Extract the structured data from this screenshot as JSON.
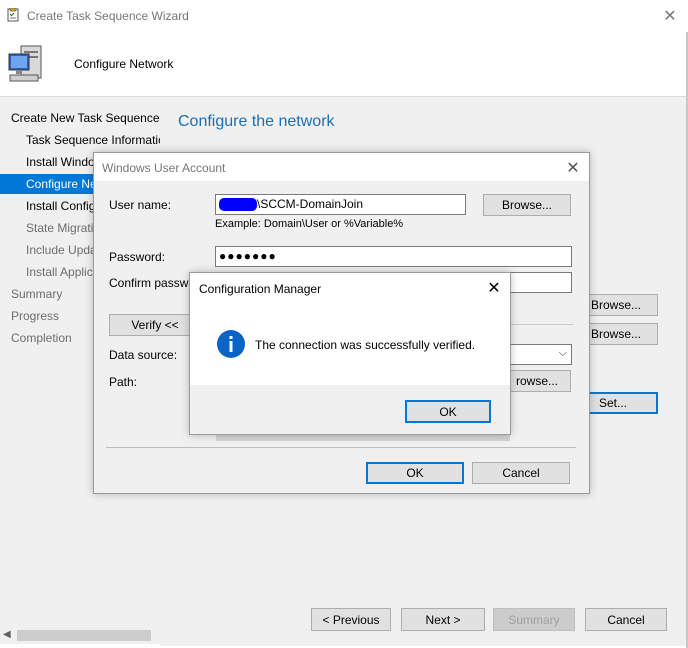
{
  "wizard": {
    "title": "Create Task Sequence Wizard",
    "header_title": "Configure Network",
    "page_heading": "Configure the network",
    "nav": [
      {
        "label": "Create New Task Sequence",
        "state": "normal"
      },
      {
        "label": "Task Sequence Informatic",
        "state": "normal"
      },
      {
        "label": "Install Windo",
        "state": "normal"
      },
      {
        "label": "Configure Ne",
        "state": "selected"
      },
      {
        "label": "Install Config",
        "state": "normal"
      },
      {
        "label": "State Migrati",
        "state": "muted"
      },
      {
        "label": "Include Upda",
        "state": "muted"
      },
      {
        "label": "Install Applic",
        "state": "muted"
      },
      {
        "label": "Summary",
        "state": "muted"
      },
      {
        "label": "Progress",
        "state": "muted"
      },
      {
        "label": "Completion",
        "state": "muted"
      }
    ],
    "behind_buttons": {
      "browse1": "Browse...",
      "browse2": "Browse...",
      "set": "Set..."
    },
    "footer": {
      "previous": "< Previous",
      "next": "Next >",
      "summary": "Summary",
      "cancel": "Cancel"
    },
    "colors": {
      "accent": "#0078d7",
      "heading": "#1a6fb3",
      "nav_selected_bg": "#0078d7"
    }
  },
  "account_dialog": {
    "title": "Windows User Account",
    "user_label": "User name:",
    "user_value": "\\SCCM-DomainJoin",
    "user_example": "Example: Domain\\User or %Variable%",
    "browse": "Browse...",
    "password_label": "Password:",
    "password_value": "●●●●●●●",
    "confirm_label": "Confirm password",
    "verify": "Verify <<",
    "data_source_label": "Data source:",
    "path_label": "Path:",
    "path_browse": "rowse...",
    "ok": "OK",
    "cancel": "Cancel"
  },
  "cm_dialog": {
    "title": "Configuration Manager",
    "message": "The connection was successfully verified.",
    "ok": "OK",
    "icon": "info-icon"
  }
}
